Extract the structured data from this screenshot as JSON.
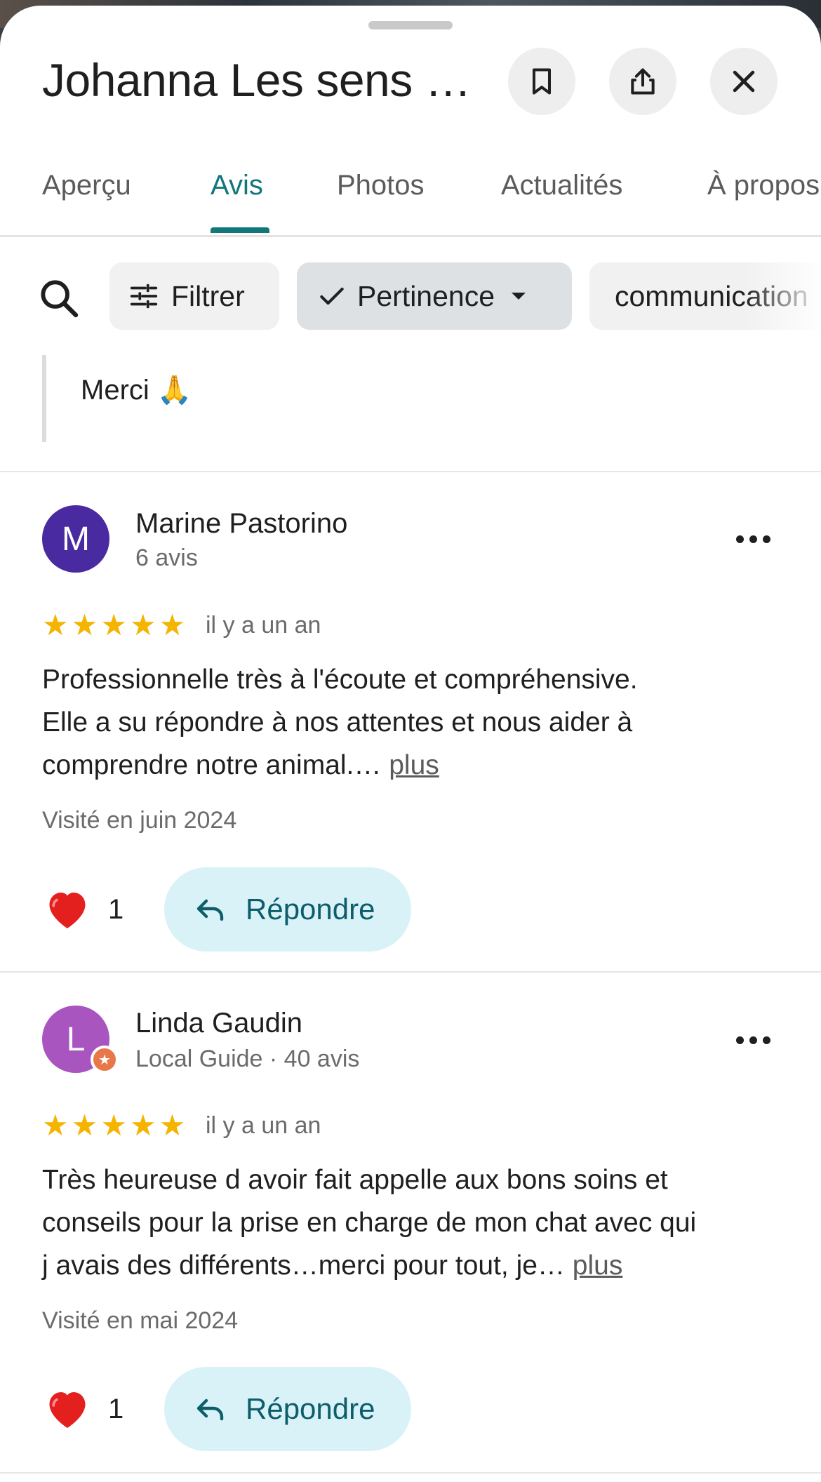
{
  "header": {
    "title": "Johanna Les sens a…",
    "save_icon": "bookmark-icon",
    "share_icon": "share-icon",
    "close_icon": "close-icon"
  },
  "tabs": [
    {
      "label": "Aperçu"
    },
    {
      "label": "Avis",
      "active": true
    },
    {
      "label": "Photos"
    },
    {
      "label": "Actualités"
    },
    {
      "label": "À propos"
    }
  ],
  "filters": {
    "filter_label": "Filtrer",
    "sort_label": "Pertinence",
    "topic_label": "communication"
  },
  "owner_reply": {
    "text": "Merci 🙏"
  },
  "reviews": [
    {
      "avatar_letter": "M",
      "avatar_color": "#4a2aa0",
      "name": "Marine Pastorino",
      "meta": "6 avis",
      "rating": 5,
      "time": "il y a un an",
      "text_line1": "Professionnelle très à l'écoute et compréhensive.",
      "text_line2": "Elle a su répondre à nos attentes et nous aider à",
      "text_line3": "comprendre notre animal.…",
      "more_label": "plus",
      "visited": "Visité en juin 2024",
      "likes": "1",
      "reply_label": "Répondre"
    },
    {
      "avatar_letter": "L",
      "avatar_color": "#a855c0",
      "local_guide": true,
      "name": "Linda Gaudin",
      "meta": "Local Guide · 40 avis",
      "rating": 5,
      "time": "il y a un an",
      "text_line1": "Très heureuse d avoir fait appelle aux bons soins et",
      "text_line2": "conseils pour la prise en charge de mon chat avec qui",
      "text_line3": "j avais des différents…merci pour tout, je…",
      "more_label": "plus",
      "visited": "Visité en mai 2024",
      "likes": "1",
      "reply_label": "Répondre"
    }
  ],
  "colors": {
    "accent": "#12777b",
    "star": "#f4b400",
    "reply_button_bg": "#d9f2f8"
  }
}
